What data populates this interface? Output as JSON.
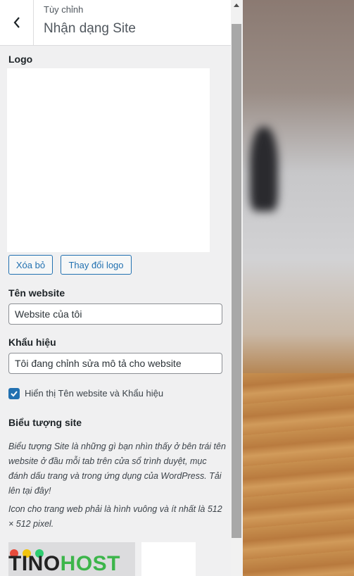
{
  "header": {
    "breadcrumb": "Tùy chỉnh",
    "title": "Nhận dạng Site"
  },
  "logo": {
    "label": "Logo",
    "remove_label": "Xóa bỏ",
    "change_label": "Thay đổi logo"
  },
  "site_title": {
    "label": "Tên website",
    "value": "Website của tôi"
  },
  "tagline": {
    "label": "Khẩu hiệu",
    "value": "Tôi đang chỉnh sửa mô tả cho website"
  },
  "display_toggle": {
    "label": "Hiển thị Tên website và Khẩu hiệu",
    "checked": true
  },
  "site_icon": {
    "label": "Biểu tượng site",
    "description_1": "Biểu tượng Site là những gì bạn nhìn thấy ở bên trái tên website ở đầu mỗi tab trên cửa sổ trình duyệt, mục đánh dấu trang và trong ứng dụng của WordPress. Tải lên tại đây!",
    "description_2": "Icon cho trang web phải là hình vuông và ít nhất là 512 × 512 pixel."
  },
  "watermark": {
    "brand_part1": "TINO",
    "brand_part2": "HOST"
  },
  "colors": {
    "accent": "#2271b1",
    "brand_green": "#3cb54a"
  }
}
